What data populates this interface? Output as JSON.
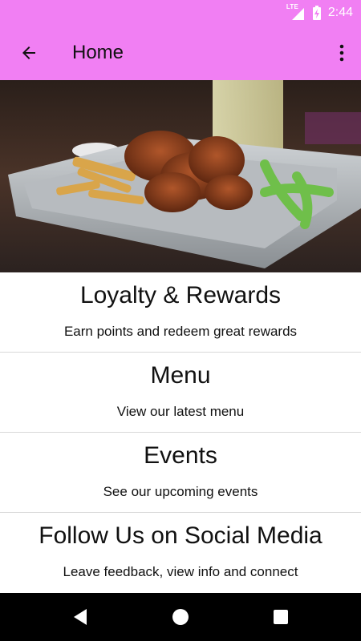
{
  "status_bar": {
    "network": "LTE",
    "time": "2:44"
  },
  "app_bar": {
    "title": "Home",
    "back_icon": "arrow-back-icon",
    "overflow_icon": "more-vert-icon",
    "background_color": "#f17ff3"
  },
  "hero": {
    "description_icon": "food-photo"
  },
  "menu_items": [
    {
      "title": "Loyalty & Rewards",
      "subtitle": "Earn points and redeem great rewards"
    },
    {
      "title": "Menu",
      "subtitle": "View our latest menu"
    },
    {
      "title": "Events",
      "subtitle": "See our upcoming events"
    },
    {
      "title": "Follow Us on Social Media",
      "subtitle": "Leave feedback, view info and connect"
    }
  ],
  "nav_bar": {
    "back_icon": "nav-back-icon",
    "home_icon": "nav-home-icon",
    "recents_icon": "nav-recents-icon"
  }
}
